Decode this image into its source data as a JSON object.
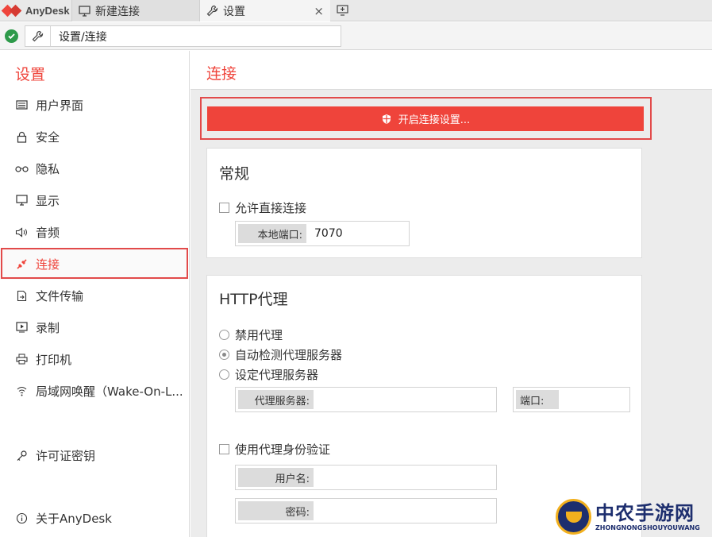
{
  "tabbar": {
    "brand": "AnyDesk",
    "tabs": [
      {
        "label": "新建连接",
        "icon": "monitor-icon"
      },
      {
        "label": "设置",
        "icon": "wrench-icon",
        "close": "×"
      }
    ]
  },
  "addressbar": {
    "status": "connected",
    "value": "设置/连接"
  },
  "sidebar": {
    "title": "设置",
    "items": [
      {
        "label": "用户界面",
        "icon": "keyboard-icon"
      },
      {
        "label": "安全",
        "icon": "lock-icon"
      },
      {
        "label": "隐私",
        "icon": "glasses-icon"
      },
      {
        "label": "显示",
        "icon": "monitor-icon"
      },
      {
        "label": "音频",
        "icon": "speaker-icon"
      },
      {
        "label": "连接",
        "icon": "connection-icon",
        "active": true
      },
      {
        "label": "文件传输",
        "icon": "file-transfer-icon"
      },
      {
        "label": "录制",
        "icon": "record-icon"
      },
      {
        "label": "打印机",
        "icon": "printer-icon"
      },
      {
        "label": "局域网唤醒（Wake-On-L...",
        "icon": "wifi-icon"
      }
    ],
    "license": {
      "label": "许可证密钥",
      "icon": "key-icon"
    },
    "about": {
      "label": "关于AnyDesk",
      "icon": "info-icon"
    }
  },
  "main": {
    "title": "连接",
    "unlock_label": "开启连接设置...",
    "general": {
      "title": "常规",
      "allow_direct": "允许直接连接",
      "allow_direct_checked": false,
      "local_port_label": "本地端口:",
      "local_port_value": "7070"
    },
    "http_proxy": {
      "title": "HTTP代理",
      "options": [
        "禁用代理",
        "自动检测代理服务器",
        "设定代理服务器"
      ],
      "selected": "自动检测代理服务器",
      "proxy_server_label": "代理服务器:",
      "proxy_server_value": "",
      "port_label": "端口:",
      "port_value": "",
      "use_auth": "使用代理身份验证",
      "use_auth_checked": false,
      "username_label": "用户名:",
      "username_value": "",
      "password_label": "密码:",
      "password_value": ""
    }
  },
  "watermark": {
    "title": "中农手游网",
    "subtitle": "ZHONGNONGSHOUYOUWANG"
  },
  "colors": {
    "accent": "#ef443b",
    "highlight_box": "#e24a4a",
    "status_ok": "#2e9a4a"
  }
}
